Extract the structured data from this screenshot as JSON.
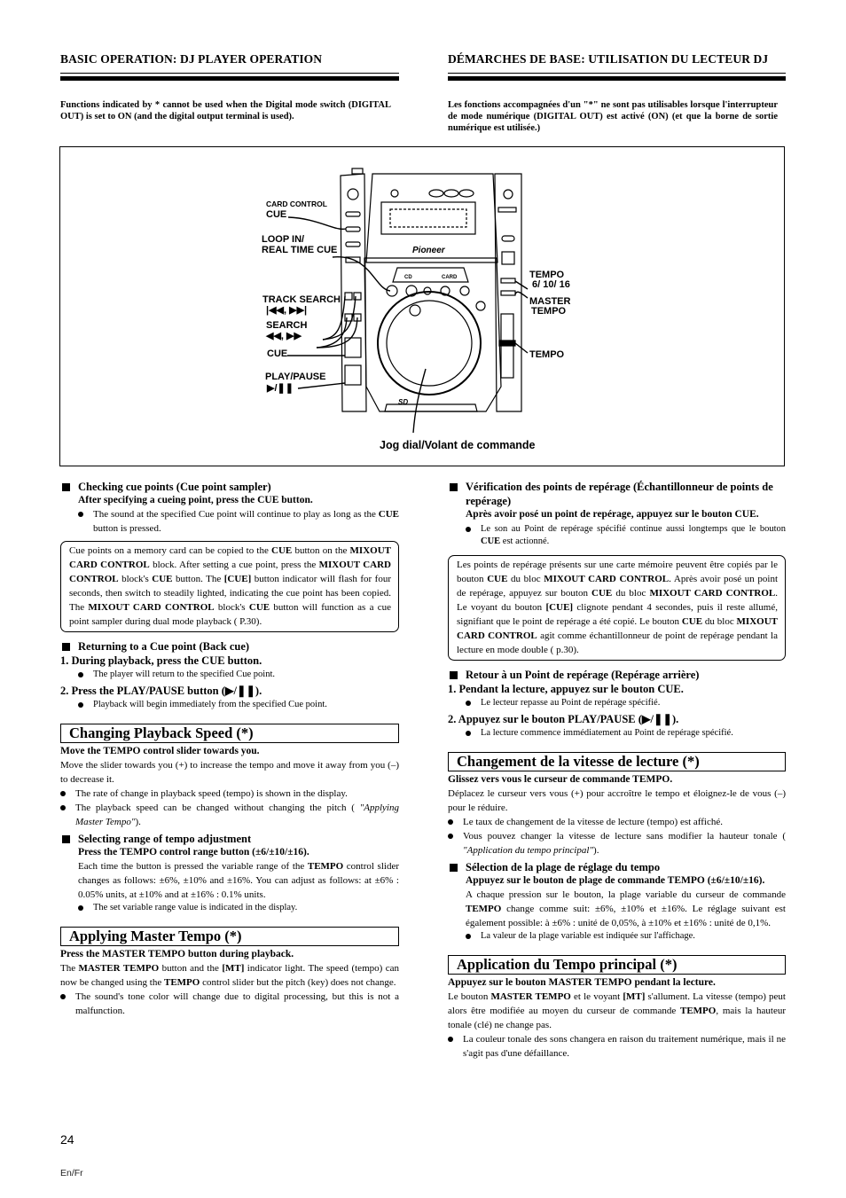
{
  "header": {
    "left_title": "BASIC OPERATION: DJ PLAYER OPERATION",
    "right_title": "DÉMARCHES DE BASE: UTILISATION DU LECTEUR DJ",
    "left_note": "Functions indicated by * cannot be used when the Digital mode switch (DIGITAL OUT) is set to ON (and the digital output terminal is used).",
    "right_note": "Les fonctions accompagnées d'un \"*\" ne sont pas utilisables lorsque l'interrupteur de mode numérique (DIGITAL OUT) est activé (ON) (et que la borne de sortie numérique est utilisée.)"
  },
  "figure": {
    "labels": {
      "card_control": "CARD CONTROL",
      "card_cue": "CUE",
      "loop_in_1": "LOOP IN/",
      "loop_in_2": "REAL TIME CUE",
      "track_search": "TRACK SEARCH",
      "track_search_icons": "|◀◀, ▶▶|",
      "search": "SEARCH",
      "search_icons": "◀◀, ▶▶",
      "cue": "CUE",
      "play_pause": "PLAY/PAUSE",
      "play_pause_icon": "▶/❚❚",
      "tempo_range_1": "TEMPO",
      "tempo_range_2": "6/  10/  16",
      "master_tempo_1": "MASTER",
      "master_tempo_2": "TEMPO",
      "tempo": "TEMPO",
      "jog_dial": "Jog dial/Volant de commande"
    },
    "device": {
      "brand": "Pioneer",
      "cd_label": "CD",
      "card_label": "CARD",
      "tempo_label": "TEMPO"
    }
  },
  "left": {
    "s1": {
      "heading": "Checking cue points (Cue point sampler)",
      "instruction": "After specifying a cueing point, press the CUE button.",
      "bullet_pre": "The sound at the specified Cue point will continue to play as long as the ",
      "bullet_bold": "CUE",
      "bullet_post": " button is pressed.",
      "box": {
        "t1": "Cue points on a memory card can be copied to the ",
        "b1": "CUE",
        "t2": " button on the ",
        "b2": "MIXOUT CARD CONTROL",
        "t3": " block. After setting a cue point, press the ",
        "b3": "MIXOUT CARD CONTROL",
        "t4": " block's ",
        "b4": "CUE",
        "t5": " button. The ",
        "b5": "[CUE]",
        "t6": " button indicator will flash for four seconds, then switch to steadily lighted, indicating the cue point has been copied. The ",
        "b6": "MIXOUT CARD CONTROL",
        "t7": " block's ",
        "b7": "CUE",
        "t8": " button will function as a cue point sampler during dual mode playback (     P.30)."
      }
    },
    "s2": {
      "heading": "Returning to a Cue point (Back cue)",
      "step1": "1.  During playback, press the CUE button.",
      "step1_bullet": "The player will return to the specified Cue point.",
      "step2": "2.  Press the PLAY/PAUSE button (▶/❚❚).",
      "step2_bullet": "Playback will begin immediately from the specified Cue point."
    },
    "s3": {
      "title": "Changing Playback Speed (*)",
      "instruction": "Move the TEMPO control slider towards you.",
      "para": "Move the slider towards you (+) to increase the tempo and move it away from you (–) to decrease it.",
      "bullet1": "The rate of change in playback speed (tempo) is shown in the display.",
      "bullet2_pre": "The playback speed can be changed without changing the pitch (     ",
      "bullet2_it": "\"Applying Master Tempo\"",
      "bullet2_post": ")."
    },
    "s4": {
      "heading": "Selecting range of tempo adjustment",
      "instruction": "Press the TEMPO control range button (±6/±10/±16).",
      "para_pre": "Each time the button is pressed the variable range of the ",
      "para_bold": "TEMPO",
      "para_post": " control slider changes as follows: ±6%, ±10% and ±16%.  You can adjust as follows: at ±6% : 0.05% units, at ±10% and at ±16% : 0.1% units.",
      "bullet": "The set variable range value is indicated in the display."
    },
    "s5": {
      "title": "Applying Master Tempo (*)",
      "instruction": "Press the MASTER TEMPO button during playback.",
      "t1": "The ",
      "b1": "MASTER TEMPO",
      "t2": " button and the ",
      "b2": "[MT]",
      "t3": " indicator light. The speed (tempo) can now be changed using the ",
      "b3": "TEMPO",
      "t4": " control slider but the pitch (key) does not change.",
      "bullet": "The sound's tone color will change due to digital processing, but this is not a malfunction."
    }
  },
  "right": {
    "s1": {
      "heading": "Vérification des points de repérage (Échantillonneur de points de repérage)",
      "instruction": "Après avoir posé un point de repérage, appuyez sur le bouton CUE.",
      "bullet_pre": "Le son au Point de repérage spécifié continue aussi longtemps que le bouton ",
      "bullet_bold": "CUE",
      "bullet_post": " est actionné.",
      "box": {
        "t1": "Les points de repérage présents sur une carte mémoire peuvent être copiés par le bouton ",
        "b1": "CUE",
        "t2": " du bloc ",
        "b2": "MIXOUT CARD CONTROL",
        "t3": ". Après avoir posé un point de repérage, appuyez sur bouton ",
        "b3": "CUE",
        "t4": " du bloc ",
        "b4": "MIXOUT CARD CONTROL",
        "t5": ". Le voyant du bouton ",
        "b5": "[CUE]",
        "t6": " clignote pendant 4 secondes, puis il reste allumé, signifiant que le point de repérage a été copié. Le bouton ",
        "b6": "CUE",
        "t7": " du bloc ",
        "b7": "MIXOUT CARD CONTROL",
        "t8": " agit comme échantillonneur de point de repérage pendant la lecture en mode double (     p.30)."
      }
    },
    "s2": {
      "heading": "Retour à un Point de repérage (Repérage arrière)",
      "step1": "1.  Pendant la lecture, appuyez  sur le bouton CUE.",
      "step1_bullet": "Le lecteur repasse au Point de repérage spécifié.",
      "step2": "2.  Appuyez sur le bouton PLAY/PAUSE (▶/❚❚).",
      "step2_bullet": "La lecture commence immédiatement au Point de repérage spécifié."
    },
    "s3": {
      "title": "Changement de la vitesse de lecture (*)",
      "instruction": "Glissez vers vous le curseur de commande TEMPO.",
      "para": "Déplacez le curseur vers vous (+) pour accroître le tempo et éloignez-le de vous (–) pour le réduire.",
      "bullet1": "Le taux de changement de la vitesse de lecture (tempo) est affiché.",
      "bullet2_pre": "Vous pouvez changer la vitesse de lecture sans modifier la hauteur tonale (     ",
      "bullet2_it": "\"Application du tempo principal\"",
      "bullet2_post": ")."
    },
    "s4": {
      "heading": "Sélection de la plage de réglage du tempo",
      "instruction": "Appuyez sur le bouton de plage de commande TEMPO (±6/±10/±16).",
      "para_pre": "A chaque pression sur le bouton, la plage variable du curseur de commande ",
      "para_bold": "TEMPO",
      "para_post": " change comme suit: ±6%, ±10% et ±16%. Le réglage suivant est également possible: à ±6% : unité de 0,05%, à ±10% et ±16% : unité de 0,1%.",
      "bullet": "La valeur de la plage variable est indiquée sur l'affichage."
    },
    "s5": {
      "title": "Application du Tempo principal (*)",
      "instruction": "Appuyez sur le bouton  MASTER TEMPO pendant la lecture.",
      "t1": "Le bouton ",
      "b1": "MASTER TEMPO",
      "t2": " et le voyant ",
      "b2": "[MT]",
      "t3": " s'allument. La vitesse (tempo) peut alors être modifiée au moyen du curseur de commande ",
      "b3": "TEMPO",
      "t4": ", mais la hauteur tonale (clé) ne change pas.",
      "bullet": "La couleur tonale des sons changera en raison du traitement numérique, mais il ne s'agit pas d'une défaillance."
    }
  },
  "footer": {
    "page_number": "24",
    "language": "En/Fr"
  }
}
